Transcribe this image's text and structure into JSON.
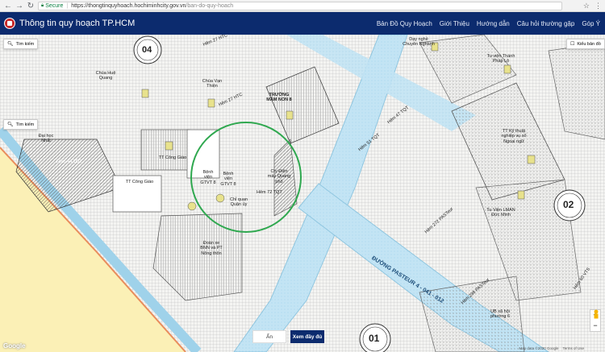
{
  "browser": {
    "back": "←",
    "forward": "→",
    "reload": "↻",
    "secure_label": "Secure",
    "url_main": "https://thongtinquyhoach.hochiminhcity.gov.vn",
    "url_path": "/ban-do-quy-hoach",
    "star": "☆",
    "menu": "⋮"
  },
  "app": {
    "title": "Thông tin quy hoạch TP.HCM",
    "menu": [
      "Bản Đồ Quy Hoạch",
      "Giới Thiệu",
      "Hướng dẫn",
      "Câu hỏi thường gặp",
      "Góp Ý"
    ]
  },
  "map": {
    "search_button": "Tìm kiếm",
    "style_button": "Kiểu bản đồ",
    "hide_button": "Ẩn",
    "show_full_button": "Xem đầy đủ",
    "zoom_in": "+",
    "zoom_out": "−",
    "google_logo": "Google",
    "attribution": [
      "Map data ©2020 Google",
      "Terms of Use"
    ],
    "circle_color": "#2fa84f",
    "accent_color": "#0c2b6e",
    "labels": {
      "block04": "04",
      "block02": "02",
      "block01": "01",
      "hem27htc": "Hẻm 27 HTC",
      "chua_hue_quang": "Chùa Huệ Quang",
      "chua_van_thien": "Chùa Vạn Thiện",
      "hem27htc2": "Hẻm 27 HTC",
      "truong_mam_non": "TRƯỜNG MẦM NON 8",
      "day_nghe": "Dạy nghề Chuyên Nghành",
      "tu_vien_thanh_phap": "Tu viện Thánh Pháp Lộ",
      "hem47tqt": "Hẻm 47 TQT",
      "hem51tqt": "Hẻm 51 TQT",
      "tt_ky_thuat": "TT Kỹ thuật nghiệp vụ số Ngoại ngữ",
      "tt_cong_giao": "TT Công Giáo",
      "tt_cong_giao2": "TT Công Giáo",
      "benh_vien_gtvt": "Bệnh viện GTVT 8",
      "benh_vien_gtvt2": "Bệnh viện GTVT 8",
      "cty_dien_may": "Cty Điện máy Quang phố",
      "hem72tqt": "Hẻm 72 TQT",
      "chi_quan": "Chỉ quan Quận ủy",
      "doan_xe": "Đoàn xe BNN và PT Nông thôn",
      "hem272pasteur": "Hẻm 272 PASTeur",
      "tu_vien_duc_minh": "Tu Viện LMAN Đức Minh",
      "hem298pasteur": "Hẻm 298 PASTeur",
      "hem60vts": "Hẻm 60 VTS",
      "duong_pasteur": "ĐƯỜNG PASTEUR 4 - 041 - 012",
      "ub_xa_hoi": "UB xã hội phường 6",
      "dai_hoc": "Đại học Nhất",
      "hem44tqt": "Hẻm 44 TQT",
      "trung_tam": "TT Công Giáo"
    }
  }
}
